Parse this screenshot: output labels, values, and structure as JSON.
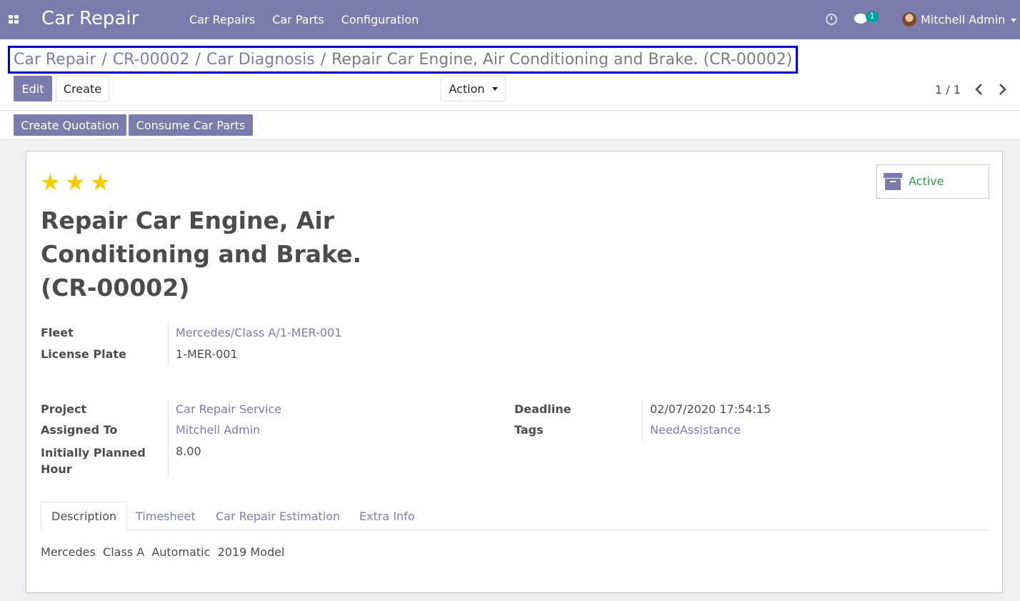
{
  "navbar": {
    "brand": "Car Repair",
    "menu": [
      "Car Repairs",
      "Car Parts",
      "Configuration"
    ],
    "chat_count": "1",
    "user": "Mitchell Admin",
    "icons": [
      "apps-icon",
      "clock-icon",
      "chat-icon",
      "avatar"
    ]
  },
  "breadcrumb": {
    "items": [
      "Car Repair",
      "CR-00002",
      "Car Diagnosis"
    ],
    "separator": "/",
    "current": "Repair Car Engine, Air Conditioning and Brake. (CR-00002)"
  },
  "toolbar": {
    "edit": "Edit",
    "create": "Create",
    "action": "Action",
    "pager": "1 / 1"
  },
  "statusbar": {
    "create_quotation": "Create Quotation",
    "consume_parts": "Consume Car Parts"
  },
  "record": {
    "priority_stars": 3,
    "status_button": "Active",
    "title": "Repair Car Engine, Air Conditioning and Brake. (CR-00002)",
    "fleet_label": "Fleet",
    "fleet_value": "Mercedes/Class A/1-MER-001",
    "plate_label": "License Plate",
    "plate_value": "1-MER-001",
    "project_label": "Project",
    "project_value": "Car Repair Service",
    "assigned_label": "Assigned To",
    "assigned_value": "Mitchell Admin",
    "hours_label": "Initially Planned Hour",
    "hours_value": "8.00",
    "deadline_label": "Deadline",
    "deadline_value": "02/07/2020 17:54:15",
    "tags_label": "Tags",
    "tags_value": "NeedAssistance"
  },
  "tabs": [
    "Description",
    "Timesheet",
    "Car Repair Estimation",
    "Extra Info"
  ],
  "description": "Mercedes  Class A  Automatic  2019 Model",
  "colors": {
    "brand": "#7c7bad",
    "highlight_box": "#0000e0",
    "star": "#f3cc00",
    "active": "#28a745",
    "badge": "#00a09d"
  }
}
